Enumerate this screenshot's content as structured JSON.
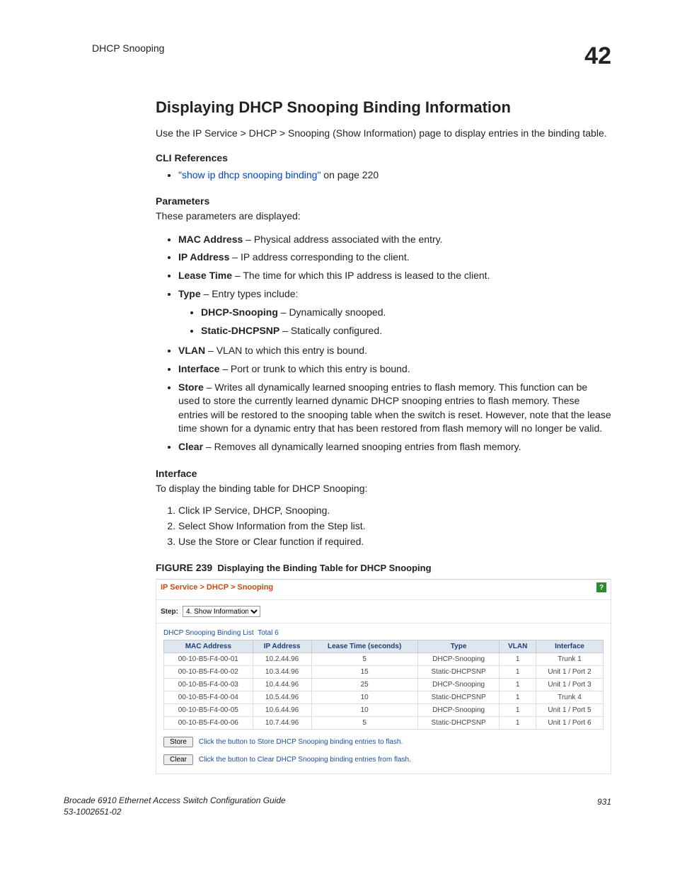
{
  "header": {
    "section": "DHCP Snooping",
    "chapter": "42"
  },
  "title": "Displaying DHCP Snooping Binding Information",
  "intro": "Use the IP Service > DHCP > Snooping (Show Information) page to display entries in the binding table.",
  "cli": {
    "heading": "CLI References",
    "link_text": "\"show ip dhcp snooping binding\"",
    "link_suffix": " on page 220"
  },
  "params": {
    "heading": "Parameters",
    "intro": "These parameters are displayed:",
    "items": {
      "mac": {
        "term": "MAC Address",
        "desc": " – Physical address associated with the entry."
      },
      "ip": {
        "term": "IP Address",
        "desc": " – IP address corresponding to the client."
      },
      "lease": {
        "term": "Lease Time",
        "desc": " – The time for which this IP address is leased to the client."
      },
      "type": {
        "term": "Type",
        "desc": " – Entry types include:"
      },
      "type_sub": {
        "snoop": {
          "term": "DHCP-Snooping",
          "desc": " – Dynamically snooped."
        },
        "static": {
          "term": "Static-DHCPSNP",
          "desc": " – Statically configured."
        }
      },
      "vlan": {
        "term": "VLAN",
        "desc": " – VLAN to which this entry is bound."
      },
      "iface": {
        "term": "Interface",
        "desc": " – Port or trunk to which this entry is bound."
      },
      "store": {
        "term": "Store",
        "desc": " – Writes all dynamically learned snooping entries to flash memory. This function can be used to store the currently learned dynamic DHCP snooping entries to flash memory. These entries will be restored to the snooping table when the switch is reset. However, note that the lease time shown for a dynamic entry that has been restored from flash memory will no longer be valid."
      },
      "clear": {
        "term": "Clear",
        "desc": " – Removes all dynamically learned snooping entries from flash memory."
      }
    }
  },
  "iface_section": {
    "heading": "Interface",
    "intro": "To display the binding table for DHCP Snooping:",
    "steps": [
      "Click IP Service, DHCP, Snooping.",
      "Select Show Information from the Step list.",
      "Use the Store or Clear function if required."
    ]
  },
  "figure": {
    "label": "FIGURE 239",
    "caption": "Displaying the Binding Table for DHCP Snooping"
  },
  "panel": {
    "breadcrumb": "IP Service > DHCP > Snooping",
    "step_label": "Step:",
    "step_value": "4. Show Information",
    "list_title": "DHCP Snooping Binding List",
    "total_label": "Total",
    "total_value": "6",
    "columns": [
      "MAC Address",
      "IP Address",
      "Lease Time (seconds)",
      "Type",
      "VLAN",
      "Interface"
    ],
    "rows": [
      {
        "mac": "00-10-B5-F4-00-01",
        "ip": "10.2.44.96",
        "lease": "5",
        "type": "DHCP-Snooping",
        "vlan": "1",
        "iface": "Trunk 1"
      },
      {
        "mac": "00-10-B5-F4-00-02",
        "ip": "10.3.44.96",
        "lease": "15",
        "type": "Static-DHCPSNP",
        "vlan": "1",
        "iface": "Unit 1 / Port 2"
      },
      {
        "mac": "00-10-B5-F4-00-03",
        "ip": "10.4.44.96",
        "lease": "25",
        "type": "DHCP-Snooping",
        "vlan": "1",
        "iface": "Unit 1 / Port 3"
      },
      {
        "mac": "00-10-B5-F4-00-04",
        "ip": "10.5.44.96",
        "lease": "10",
        "type": "Static-DHCPSNP",
        "vlan": "1",
        "iface": "Trunk 4"
      },
      {
        "mac": "00-10-B5-F4-00-05",
        "ip": "10.6.44.96",
        "lease": "10",
        "type": "DHCP-Snooping",
        "vlan": "1",
        "iface": "Unit 1 / Port 5"
      },
      {
        "mac": "00-10-B5-F4-00-06",
        "ip": "10.7.44.96",
        "lease": "5",
        "type": "Static-DHCPSNP",
        "vlan": "1",
        "iface": "Unit 1 / Port 6"
      }
    ],
    "store_btn": "Store",
    "store_desc": "Click the button to Store DHCP Snooping binding entries to flash.",
    "clear_btn": "Clear",
    "clear_desc": "Click the button to Clear DHCP Snooping binding entries from flash."
  },
  "footer": {
    "line1": "Brocade 6910 Ethernet Access Switch Configuration Guide",
    "line2": "53-1002651-02",
    "page": "931"
  }
}
